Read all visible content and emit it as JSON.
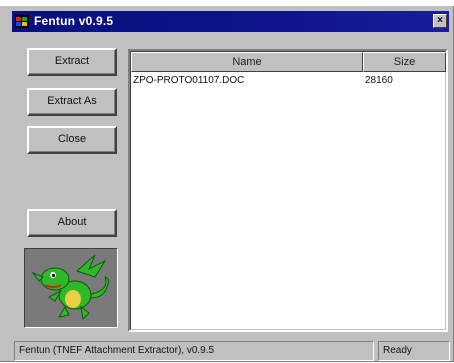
{
  "window": {
    "title": "Fentun v0.9.5",
    "close_glyph": "×",
    "icon": "app-icon"
  },
  "buttons": {
    "extract": "Extract",
    "extract_as": "Extract As",
    "close": "Close",
    "about": "About"
  },
  "logo": {
    "icon": "dragon-icon",
    "color": "#2fb82a"
  },
  "table": {
    "columns": [
      "Name",
      "Size"
    ],
    "rows": [
      {
        "name": "ZPO-PROTO01107.DOC",
        "size": "28160"
      }
    ]
  },
  "status": {
    "message": "Fentun (TNEF Attachment Extractor), v0.9.5",
    "state": "Ready"
  }
}
